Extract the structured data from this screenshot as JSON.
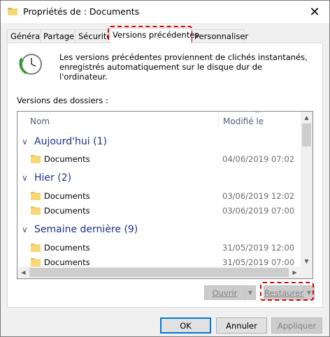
{
  "window": {
    "title": "Propriétés de : Documents",
    "close_glyph": "✕"
  },
  "tabs": [
    {
      "label": "Général"
    },
    {
      "label": "Partage"
    },
    {
      "label": "Sécurité"
    },
    {
      "label": "Versions précédentes"
    },
    {
      "label": "Personnaliser"
    }
  ],
  "active_tab": "Versions précédentes",
  "info": {
    "text": "Les versions précédentes proviennent de clichés instantanés, enregistrés automatiquement sur le disque dur de l'ordinateur.",
    "icon": "restore-clock-icon"
  },
  "versions_label": "Versions des dossiers :",
  "columns": {
    "name": "Nom",
    "modified": "Modifié le"
  },
  "groups": [
    {
      "label": "Aujourd'hui (1)",
      "items": [
        {
          "name": "Documents",
          "date": "04/06/2019 07:02"
        }
      ]
    },
    {
      "label": "Hier (2)",
      "items": [
        {
          "name": "Documents",
          "date": "03/06/2019 12:02"
        },
        {
          "name": "Documents",
          "date": "03/06/2019 07:00"
        }
      ]
    },
    {
      "label": "Semaine dernière (9)",
      "items": [
        {
          "name": "Documents",
          "date": "31/05/2019 12:00"
        },
        {
          "name": "Documents",
          "date": "31/05/2019 07:00"
        }
      ]
    }
  ],
  "actions": {
    "open": "Ouvrir",
    "restore": "Restaurer"
  },
  "buttons": {
    "ok": "OK",
    "cancel": "Annuler",
    "apply": "Appliquer"
  },
  "colors": {
    "highlight": "#e00000",
    "group_text": "#1e3287",
    "folder": "#f8d775"
  }
}
